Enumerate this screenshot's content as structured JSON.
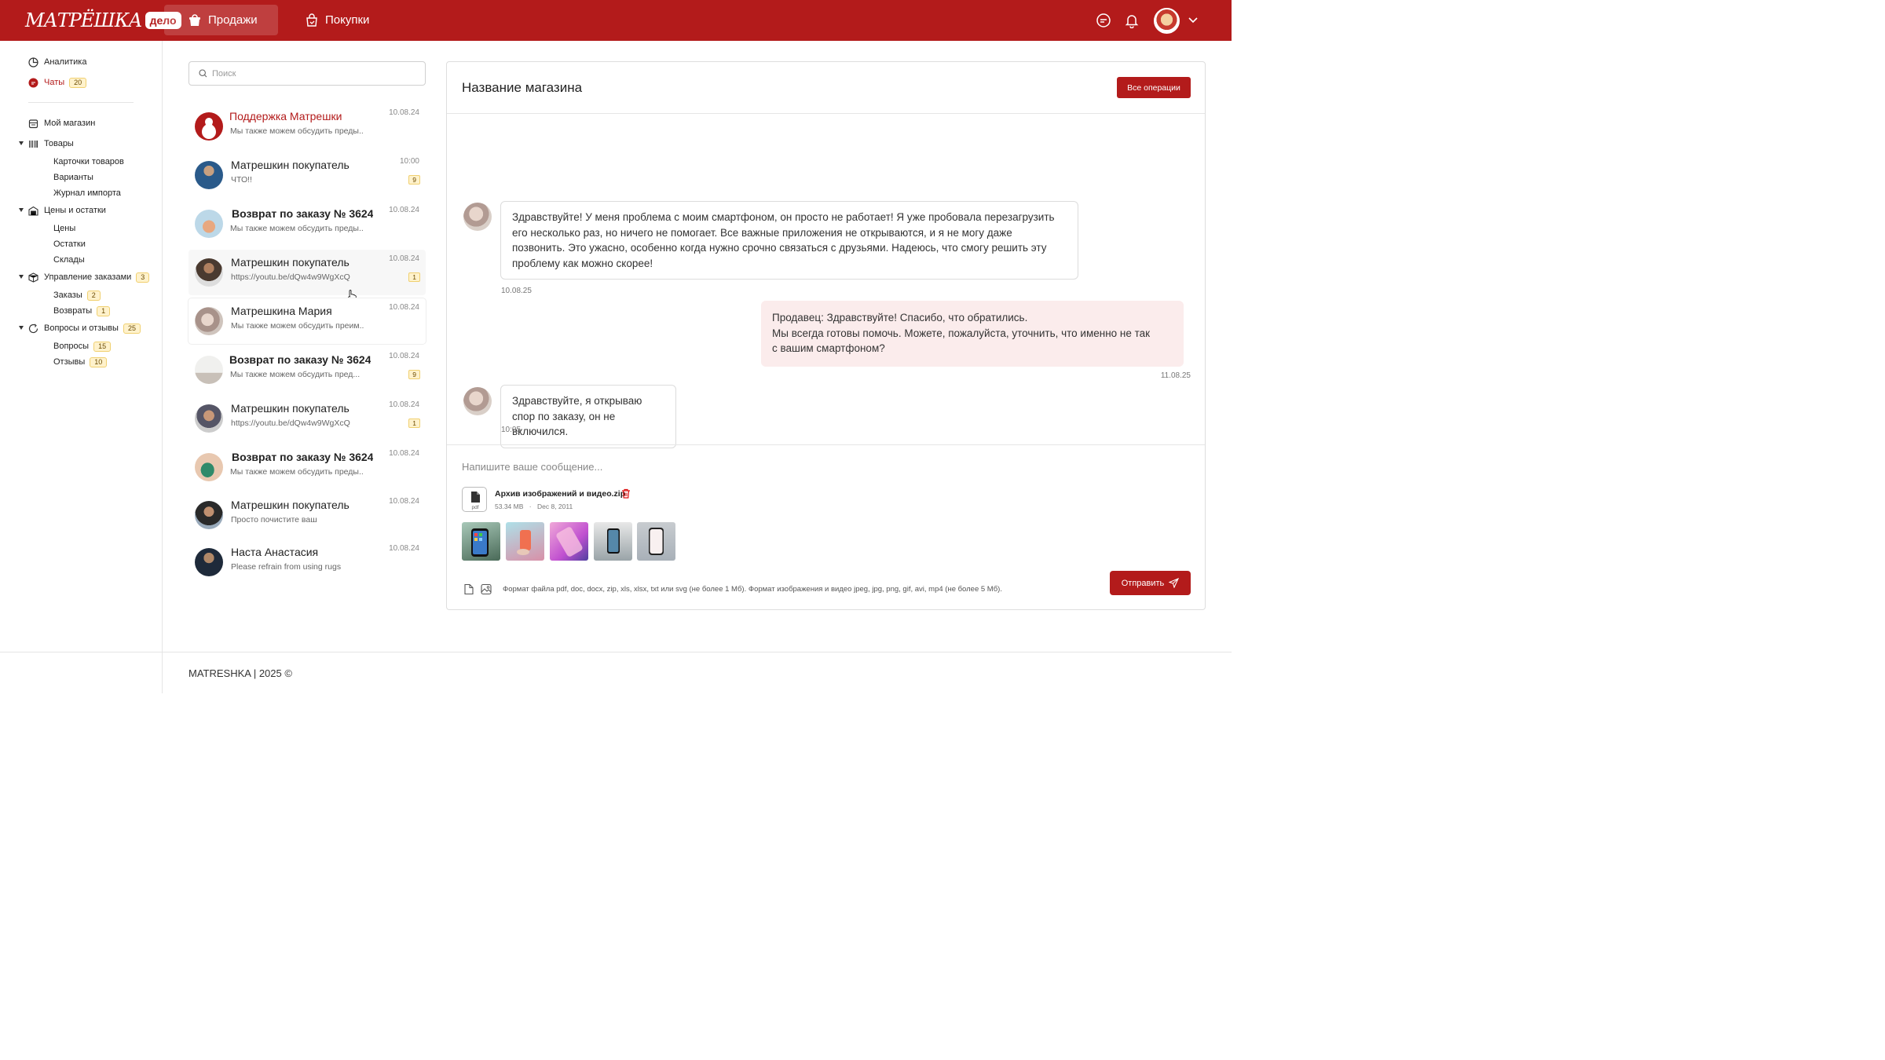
{
  "brand": {
    "logo_text": "МАТРЁШКА",
    "logo_badge": "дело",
    "accent": "#b31b1b"
  },
  "topnav": {
    "sales": "Продажи",
    "purchases": "Покупки"
  },
  "sidebar": {
    "analytics": "Аналитика",
    "chats": "Чаты",
    "chats_count": "20",
    "my_shop": "Мой магазин",
    "goods": "Товары",
    "goods_items": [
      "Карточки товаров",
      "Варианты",
      "Журнал импорта"
    ],
    "prices": "Цены и остатки",
    "prices_items": [
      "Цены",
      "Остатки",
      "Склады"
    ],
    "orders": "Управление заказами",
    "orders_count": "3",
    "orders_items": [
      {
        "label": "Заказы",
        "count": "2"
      },
      {
        "label": "Возвраты",
        "count": "1"
      }
    ],
    "qa": "Вопросы и отзывы",
    "qa_count": "25",
    "qa_items": [
      {
        "label": "Вопросы",
        "count": "15"
      },
      {
        "label": "Отзывы",
        "count": "10"
      }
    ]
  },
  "search": {
    "placeholder": "Поиск"
  },
  "chats": [
    {
      "name": "Поддержка Матрешки",
      "preview": "Мы также можем обсудить преды...",
      "date": "10.08.24",
      "badge": ""
    },
    {
      "name": "Матрешкин покупатель",
      "preview": "ЧТО!!",
      "date": "10:00",
      "badge": "9"
    },
    {
      "name": "Возврат по заказу № 3624...",
      "preview": "Мы также можем обсудить преды...",
      "date": "10.08.24",
      "badge": ""
    },
    {
      "name": "Матрешкин покупатель",
      "preview": "https://youtu.be/dQw4w9WgXcQ",
      "date": "10.08.24",
      "badge": "1"
    },
    {
      "name": "Матрешкина Мария",
      "preview": "Мы также можем обсудить преим...",
      "date": "10.08.24",
      "badge": ""
    },
    {
      "name": "Возврат по заказу № 3624...",
      "preview": "Мы также можем обсудить пред...",
      "date": "10.08.24",
      "badge": "9"
    },
    {
      "name": "Матрешкин покупатель",
      "preview": "https://youtu.be/dQw4w9WgXcQ",
      "date": "10.08.24",
      "badge": "1"
    },
    {
      "name": "Возврат по заказу № 3624...",
      "preview": "Мы также можем обсудить преды...",
      "date": "10.08.24",
      "badge": ""
    },
    {
      "name": "Матрешкин покупатель",
      "preview": "Просто почистите ваш",
      "date": "10.08.24",
      "badge": ""
    },
    {
      "name": "Наста Анастасия",
      "preview": "Please refrain from using rugs",
      "date": "10.08.24",
      "badge": ""
    }
  ],
  "panel": {
    "title": "Название магазина",
    "all_ops": "Все операции",
    "messages": [
      {
        "text": "Здравствуйте! У меня проблема с моим смартфоном, он просто не работает! Я уже пробовала перезагрузить его несколько раз, но ничего не помогает. Все важные приложения не открываются, и я не могу даже позвонить. Это ужасно, особенно когда нужно срочно связаться с друзьями. Надеюсь, что смогу решить эту проблему как можно скорее!",
        "time": "10.08.25"
      },
      {
        "text_l1": "Продавец: Здравствуйте! Спасибо, что обратились.",
        "text_l2": "Мы всегда готовы помочь. Можете, пожалуйста, уточнить, что именно не так с вашим смартфоном?",
        "time": "11.08.25"
      },
      {
        "text": "Здравствуйте, я открываю спор по заказу, он не включился.",
        "time": "10:05"
      }
    ],
    "composer_placeholder": "Напишите ваше сообщение...",
    "file": {
      "type": "pdf",
      "name": "Архив изображений и видео.zip",
      "size": "53.34 MB",
      "date": "Dec 8, 2011"
    },
    "hint": "Формат файла pdf, doc, docx, zip, xls, xlsx, txt или svg (не более 1 Мб).  Формат изображения и видео jpeg, jpg, png, gif, avi, mp4 (не более 5 Мб).",
    "send": "Отправить"
  },
  "footer": {
    "text": "MATRESHKA | 2025 ©"
  }
}
